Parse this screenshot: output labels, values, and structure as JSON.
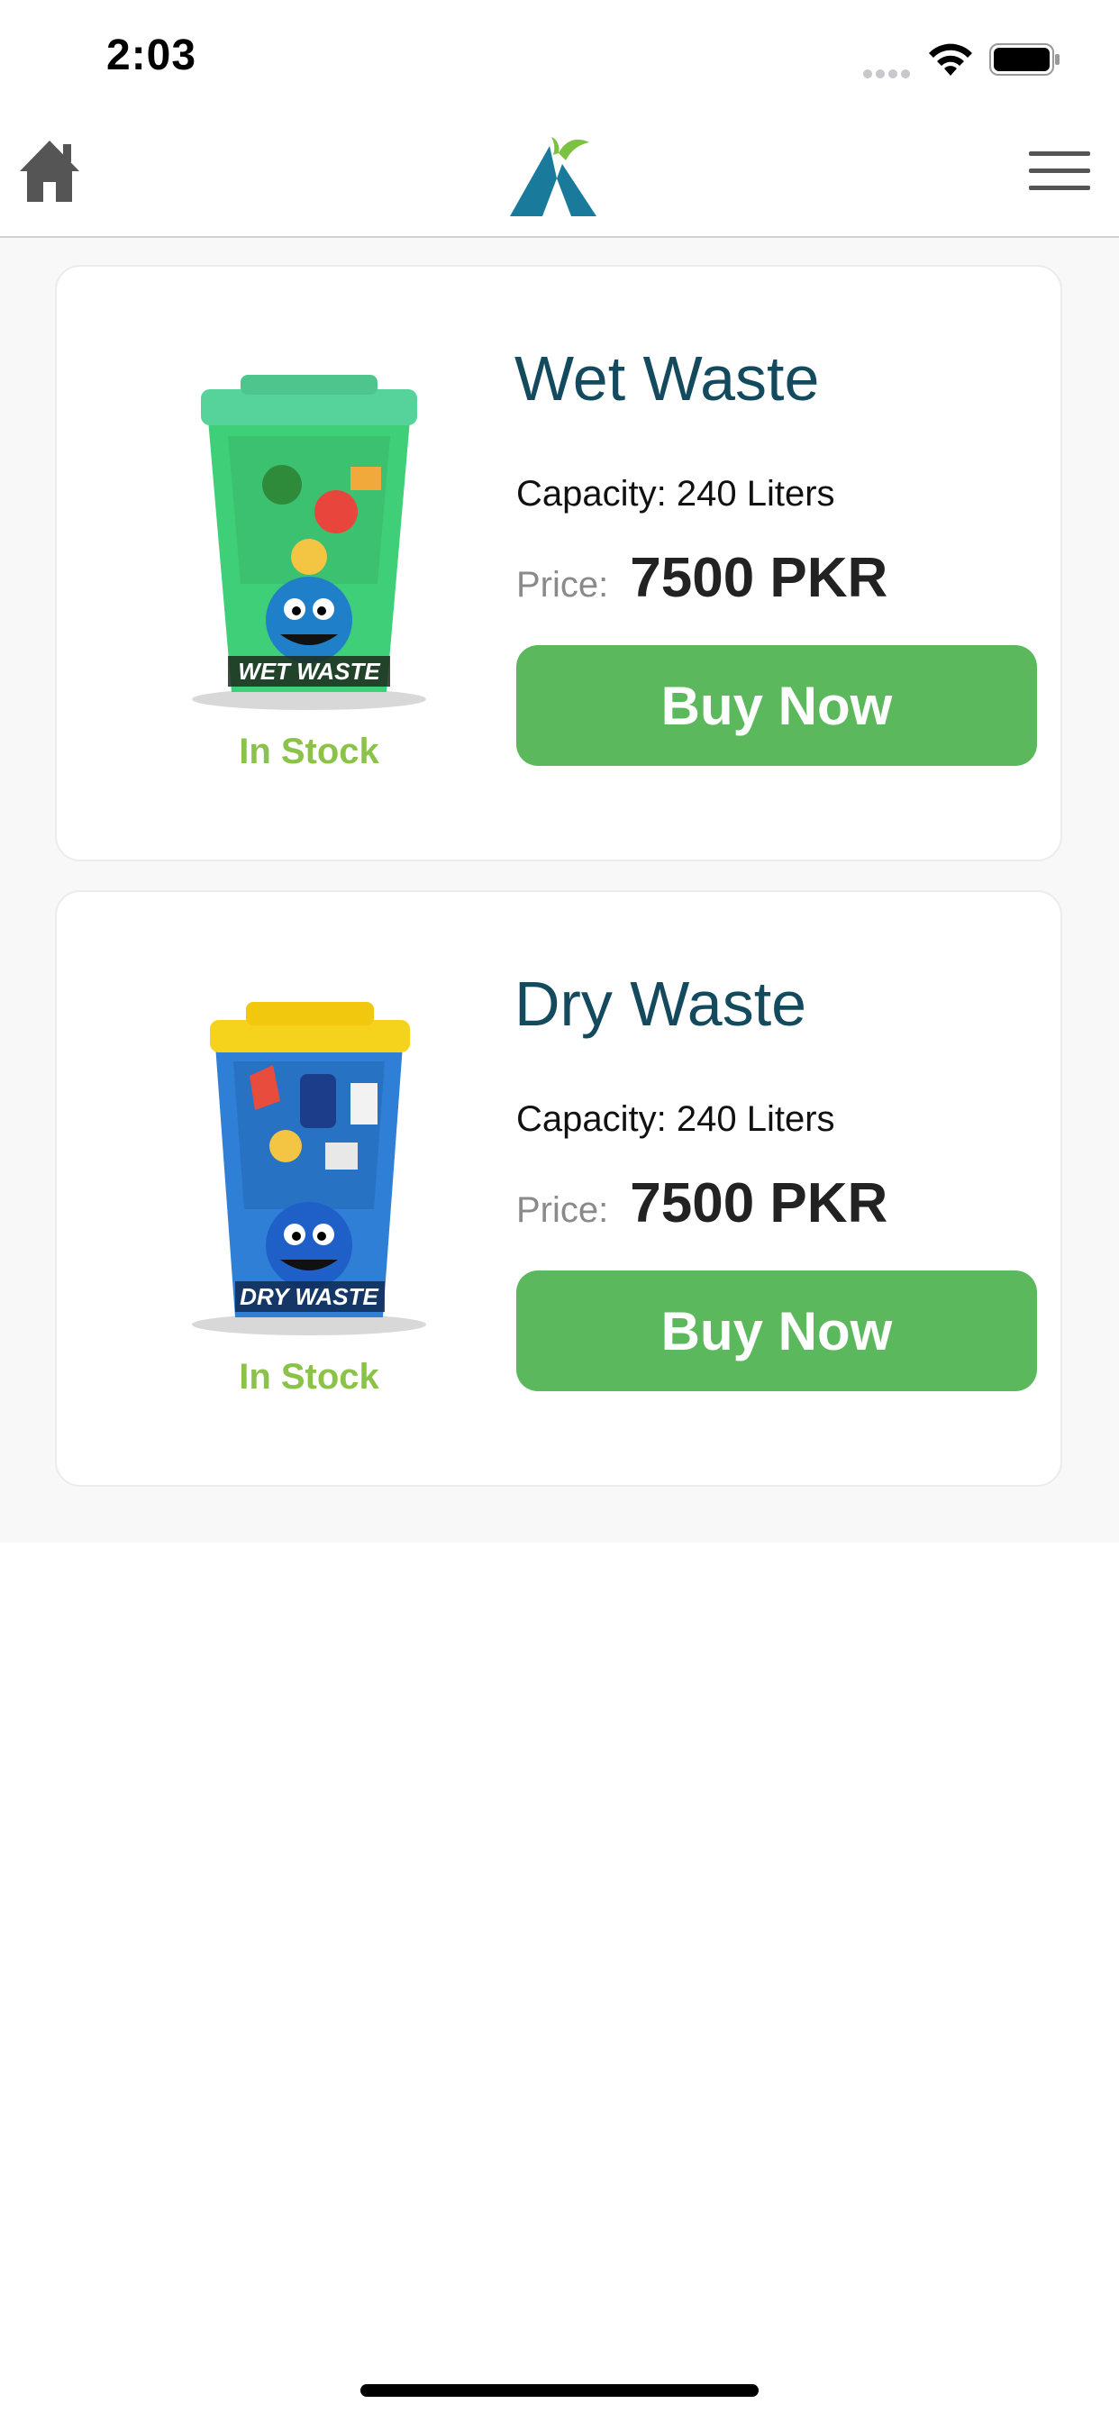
{
  "status_bar": {
    "time": "2:03"
  },
  "nav": {
    "home_icon": "home-icon",
    "logo_icon": "brand-logo",
    "menu_icon": "hamburger-menu-icon"
  },
  "colors": {
    "accent_green": "#5cb85c",
    "stock_green": "#8bc34a",
    "title_teal": "#134a5e"
  },
  "products": [
    {
      "title": "Wet Waste",
      "capacity": "Capacity: 240 Liters",
      "price_label": "Price:",
      "price": "7500 PKR",
      "buy_label": "Buy Now",
      "stock": "In Stock",
      "bin_label": "WET WASTE",
      "bin_color": "#3fcf78",
      "lid_color": "#55d39a"
    },
    {
      "title": "Dry Waste",
      "capacity": "Capacity: 240 Liters",
      "price_label": "Price:",
      "price": "7500 PKR",
      "buy_label": "Buy Now",
      "stock": "In Stock",
      "bin_label": "DRY WASTE",
      "bin_color": "#2f7fd6",
      "lid_color": "#f5d21c"
    }
  ]
}
